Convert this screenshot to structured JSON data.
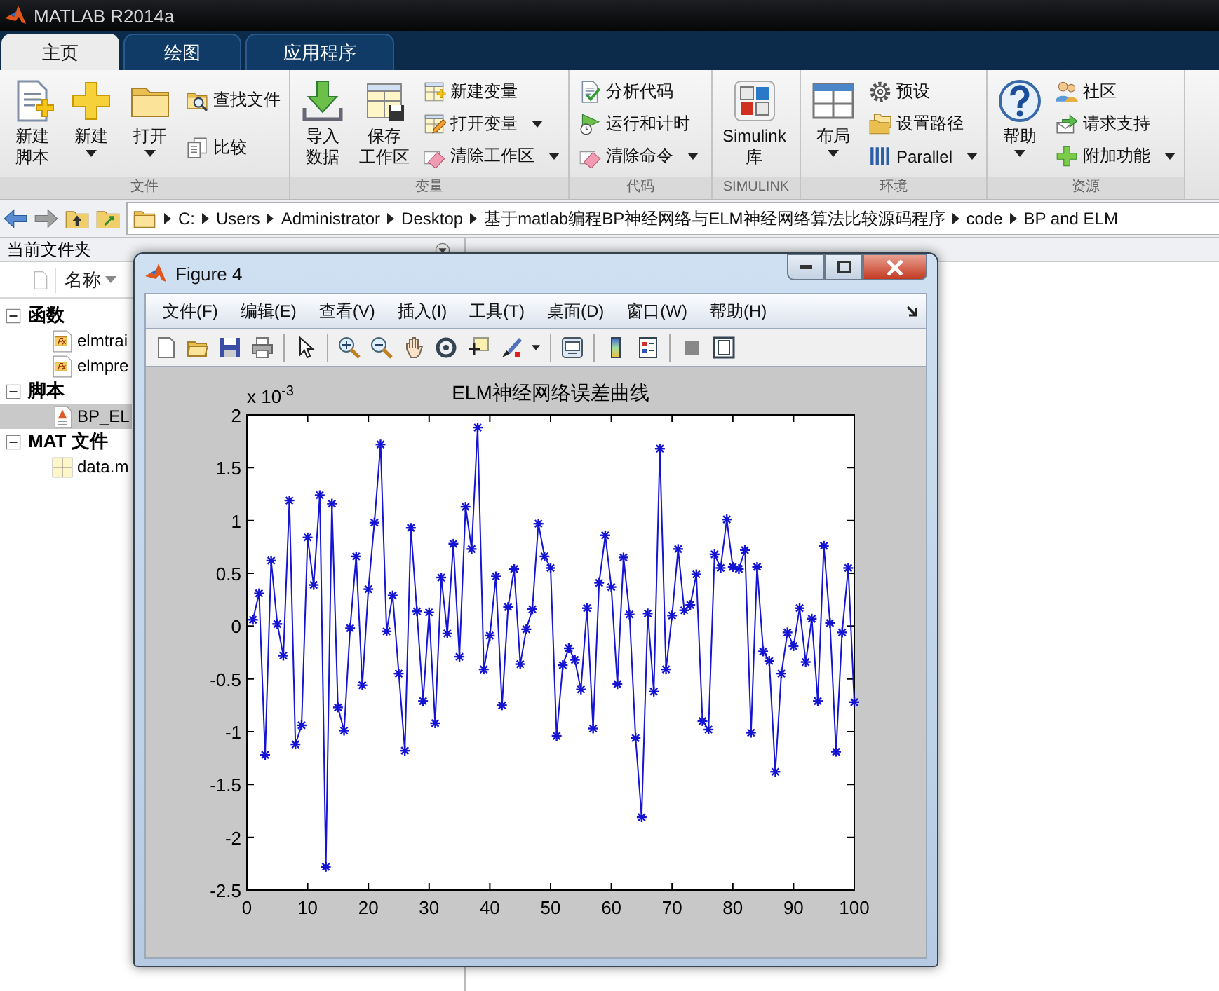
{
  "window": {
    "title": "MATLAB R2014a"
  },
  "tabs": [
    {
      "label": "主页",
      "selected": true
    },
    {
      "label": "绘图",
      "selected": false
    },
    {
      "label": "应用程序",
      "selected": false
    }
  ],
  "ribbon": {
    "sections": [
      {
        "label": "文件",
        "items": [
          {
            "kind": "large",
            "lines": [
              "新建",
              "脚本"
            ],
            "dropdown": false
          },
          {
            "kind": "large",
            "lines": [
              "新建"
            ],
            "dropdown": true
          },
          {
            "kind": "large",
            "lines": [
              "打开"
            ],
            "dropdown": true
          },
          {
            "kind": "small",
            "label": "查找文件",
            "dropdown": false
          },
          {
            "kind": "small",
            "label": "比较",
            "dropdown": false
          }
        ]
      },
      {
        "label": "变量",
        "items": [
          {
            "kind": "large",
            "lines": [
              "导入",
              "数据"
            ],
            "dropdown": false
          },
          {
            "kind": "large",
            "lines": [
              "保存",
              "工作区"
            ],
            "dropdown": false
          },
          {
            "kind": "small",
            "label": "新建变量",
            "dropdown": false
          },
          {
            "kind": "small",
            "label": "打开变量",
            "dropdown": true
          },
          {
            "kind": "small",
            "label": "清除工作区",
            "dropdown": true
          }
        ]
      },
      {
        "label": "代码",
        "items": [
          {
            "kind": "small",
            "label": "分析代码",
            "dropdown": false
          },
          {
            "kind": "small",
            "label": "运行和计时",
            "dropdown": false
          },
          {
            "kind": "small",
            "label": "清除命令",
            "dropdown": true
          }
        ]
      },
      {
        "label": "SIMULINK",
        "items": [
          {
            "kind": "large",
            "lines": [
              "Simulink",
              "库"
            ],
            "dropdown": false
          }
        ]
      },
      {
        "label": "环境",
        "items": [
          {
            "kind": "large",
            "lines": [
              "布局"
            ],
            "dropdown": true
          },
          {
            "kind": "small",
            "label": "预设",
            "dropdown": false
          },
          {
            "kind": "small",
            "label": "设置路径",
            "dropdown": false
          },
          {
            "kind": "small",
            "label": "Parallel",
            "dropdown": true
          }
        ]
      },
      {
        "label": "资源",
        "items": [
          {
            "kind": "large",
            "lines": [
              "帮助"
            ],
            "dropdown": true
          },
          {
            "kind": "small",
            "label": "社区",
            "dropdown": false
          },
          {
            "kind": "small",
            "label": "请求支持",
            "dropdown": false
          },
          {
            "kind": "small",
            "label": "附加功能",
            "dropdown": true
          }
        ]
      }
    ]
  },
  "address": {
    "path": [
      "C:",
      "Users",
      "Administrator",
      "Desktop",
      "基于matlab编程BP神经网络与ELM神经网络算法比较源码程序",
      "code",
      "BP and ELM"
    ]
  },
  "current_folder": {
    "title": "当前文件夹",
    "column": "名称",
    "groups": [
      {
        "label": "函数",
        "expanded": true,
        "children": [
          {
            "label": "elmtrai",
            "selected": false
          },
          {
            "label": "elmpre",
            "selected": false
          }
        ]
      },
      {
        "label": "脚本",
        "expanded": true,
        "children": [
          {
            "label": "BP_EL",
            "selected": true
          }
        ]
      },
      {
        "label": "MAT 文件",
        "expanded": true,
        "children": [
          {
            "label": "data.m",
            "selected": false
          }
        ]
      }
    ]
  },
  "figure": {
    "title": "Figure 4",
    "menu": [
      "文件(F)",
      "编辑(E)",
      "查看(V)",
      "插入(I)",
      "工具(T)",
      "桌面(D)",
      "窗口(W)",
      "帮助(H)"
    ],
    "y_multiplier": "x 10$^{-3}$",
    "chart_data": {
      "type": "line",
      "title": "ELM神经网络误差曲线",
      "x": [
        1,
        2,
        3,
        4,
        5,
        6,
        7,
        8,
        9,
        10,
        11,
        12,
        13,
        14,
        15,
        16,
        17,
        18,
        19,
        20,
        21,
        22,
        23,
        24,
        25,
        26,
        27,
        28,
        29,
        30,
        31,
        32,
        33,
        34,
        35,
        36,
        37,
        38,
        39,
        40,
        41,
        42,
        43,
        44,
        45,
        46,
        47,
        48,
        49,
        50,
        51,
        52,
        53,
        54,
        55,
        56,
        57,
        58,
        59,
        60,
        61,
        62,
        63,
        64,
        65,
        66,
        67,
        68,
        69,
        70,
        71,
        72,
        73,
        74,
        75,
        76,
        77,
        78,
        79,
        80,
        81,
        82,
        83,
        84,
        85,
        86,
        87,
        88,
        89,
        90,
        91,
        92,
        93,
        94,
        95,
        96,
        97,
        98,
        99,
        100
      ],
      "series": [
        {
          "color": "#1414d2",
          "marker": "cross",
          "values": [
            0.06,
            0.31,
            -1.22,
            0.62,
            0.02,
            -0.28,
            1.19,
            -1.12,
            -0.94,
            0.84,
            0.39,
            1.24,
            -2.28,
            1.16,
            -0.77,
            -0.99,
            -0.02,
            0.66,
            -0.56,
            0.35,
            0.98,
            1.72,
            -0.05,
            0.29,
            -0.45,
            -1.18,
            0.93,
            0.14,
            -0.71,
            0.13,
            -0.92,
            0.46,
            -0.07,
            0.78,
            -0.29,
            1.13,
            0.73,
            1.88,
            -0.41,
            -0.09,
            0.47,
            -0.75,
            0.18,
            0.54,
            -0.36,
            -0.03,
            0.16,
            0.97,
            0.66,
            0.55,
            -1.04,
            -0.37,
            -0.21,
            -0.32,
            -0.6,
            0.17,
            -0.97,
            0.41,
            0.86,
            0.37,
            -0.55,
            0.65,
            0.11,
            -1.06,
            -1.81,
            0.12,
            -0.62,
            1.68,
            -0.41,
            0.1,
            0.73,
            0.15,
            0.2,
            0.49,
            -0.9,
            -0.98,
            0.68,
            0.55,
            1.01,
            0.56,
            0.54,
            0.72,
            -1.01,
            0.56,
            -0.24,
            -0.33,
            -1.38,
            -0.45,
            -0.06,
            -0.19,
            0.17,
            -0.34,
            0.07,
            -0.71,
            0.76,
            0.03,
            -1.19,
            -0.06,
            0.55,
            -0.72
          ]
        }
      ],
      "xlim": [
        0,
        100
      ],
      "ylim": [
        -2.5,
        2
      ],
      "xticks": [
        0,
        10,
        20,
        30,
        40,
        50,
        60,
        70,
        80,
        90,
        100
      ],
      "yticks": [
        -2.5,
        -2,
        -1.5,
        -1,
        -0.5,
        0,
        0.5,
        1,
        1.5,
        2
      ]
    }
  }
}
